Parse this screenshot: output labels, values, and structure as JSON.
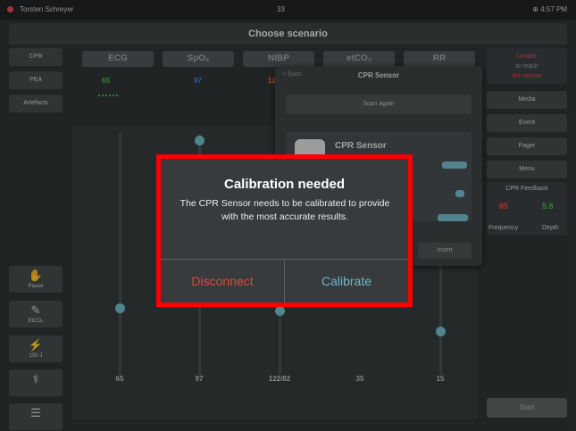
{
  "status_bar": {
    "user": "Torsten Schreyer",
    "center": "33",
    "right": "⊕ 4:57 PM"
  },
  "title": "Choose scenario",
  "left_menu": {
    "buttons": [
      "CPR",
      "PEA",
      "Artefacts"
    ],
    "tools": [
      {
        "icon": "hand-icon",
        "label": "Pause"
      },
      {
        "icon": "syringe-icon",
        "label": "EtCO₂"
      },
      {
        "icon": "defib-icon",
        "label": "150 J"
      }
    ]
  },
  "tabs": [
    "ECG",
    "SpO₂",
    "NIBP",
    "etCO₂",
    "RR"
  ],
  "vital_readouts": [
    {
      "value": "65",
      "color": "#3db84a"
    },
    {
      "value": "97",
      "color": "#3d7fd9"
    },
    {
      "value": "122",
      "color": "#e06a2e"
    }
  ],
  "bottom_values": [
    "65",
    "97",
    "122/82",
    "35",
    "15"
  ],
  "right_menu": {
    "warning": {
      "line1": "Unable",
      "line2": "to reach",
      "line3": "the sensor"
    },
    "buttons": [
      "Media",
      "Event",
      "Pager",
      "Menu"
    ],
    "cpr_feedback": {
      "title": "CPR Feedback",
      "frequency_label": "Frequency",
      "depth_label": "Depth",
      "frequency": "85",
      "depth": "5.8"
    },
    "start": "Start"
  },
  "popover": {
    "back": "< Back",
    "title": "CPR Sensor",
    "scan": "Scan again",
    "device_name": "CPR Sensor",
    "action": "Insert"
  },
  "alert": {
    "title": "Calibration needed",
    "message": "The CPR Sensor needs to be calibrated to provide with the most accurate results.",
    "disconnect": "Disconnect",
    "calibrate": "Calibrate"
  },
  "colors": {
    "accent": "#6fb8c6",
    "destructive": "#e5443f",
    "highlight": "#ff0000"
  }
}
